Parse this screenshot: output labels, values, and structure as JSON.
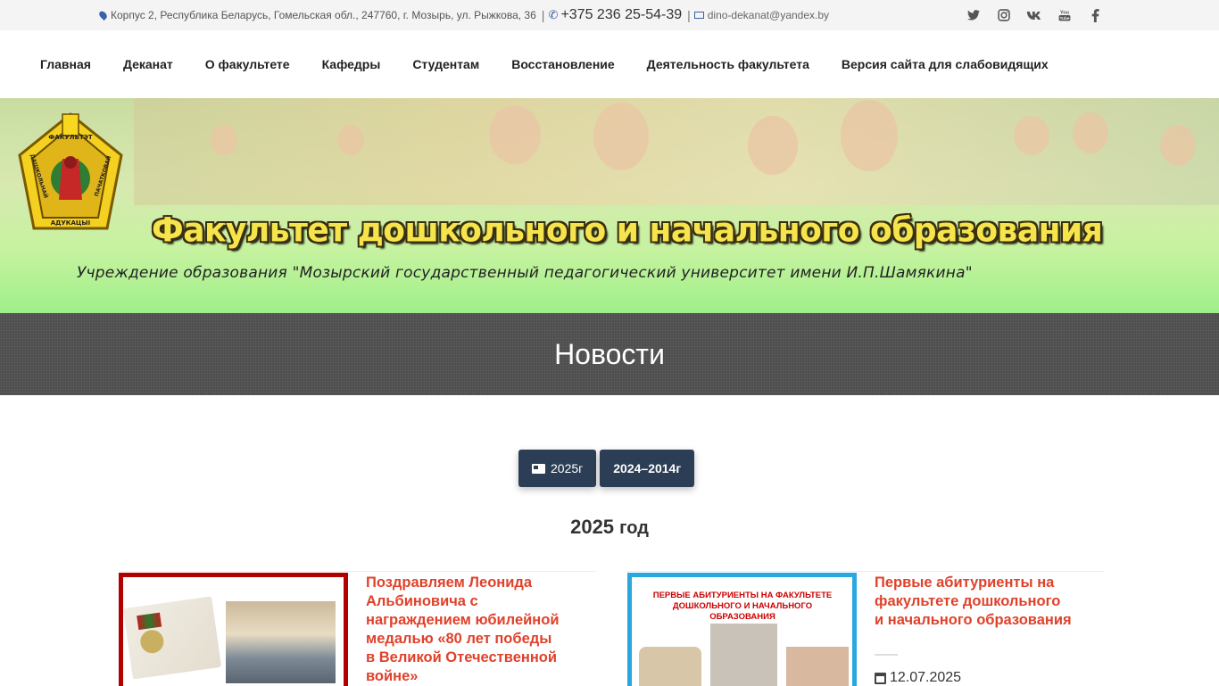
{
  "topbar": {
    "address": "Корпус 2, Республика Беларусь, Гомельская обл., 247760, г. Мозырь, ул. Рыжкова, 36",
    "phone": "+375 236 25-54-39",
    "email": "dino-dekanat@yandex.by",
    "socials": [
      {
        "icon": "twitter-icon"
      },
      {
        "icon": "instagram-icon"
      },
      {
        "icon": "vk-icon"
      },
      {
        "icon": "youtube-icon",
        "label": "You"
      },
      {
        "icon": "facebook-icon"
      }
    ]
  },
  "nav": {
    "items": [
      "Главная",
      "Деканат",
      "О факультете",
      "Кафедры",
      "Студентам",
      "Восстановление",
      "Деятельность факультета",
      "Версия сайта для слабовидящих"
    ]
  },
  "banner": {
    "title": "Факультет дошкольного и начального образования",
    "subtitle": "Учреждение образования \"Мозырский государственный педагогический университет имени И.П.Шамякина\"",
    "emblem_text": [
      "ФАКУЛЬТЭТ",
      "ДАШКОЛЬНАЙ",
      "ПАЧАТКОВАЙ",
      "АДУКАЦЫІ"
    ]
  },
  "page": {
    "heading": "Новости",
    "years": [
      "2025г",
      "2024–2014г"
    ],
    "section_title": "2025",
    "section_title_suffix": "год"
  },
  "news": [
    {
      "title": "Поздравляем Леонида Альбиновича с награждением юбилейной медалью «80 лет победы в Великой Отечественной войне»",
      "date": ""
    },
    {
      "title": "Первые абитуриенты на факультете дошкольного и начального образования",
      "date": "12.07.2025",
      "poster_text": "ПЕРВЫЕ АБИТУРИЕНТЫ НА ФАКУЛЬТЕТЕ ДОШКОЛЬНОГО И НАЧАЛЬНОГО ОБРАЗОВАНИЯ"
    }
  ],
  "colors": {
    "accent_dark": "#2c3e55",
    "news_title": "#e0412a",
    "thumb_border_1": "#b00000",
    "thumb_border_2": "#29a8e0"
  }
}
